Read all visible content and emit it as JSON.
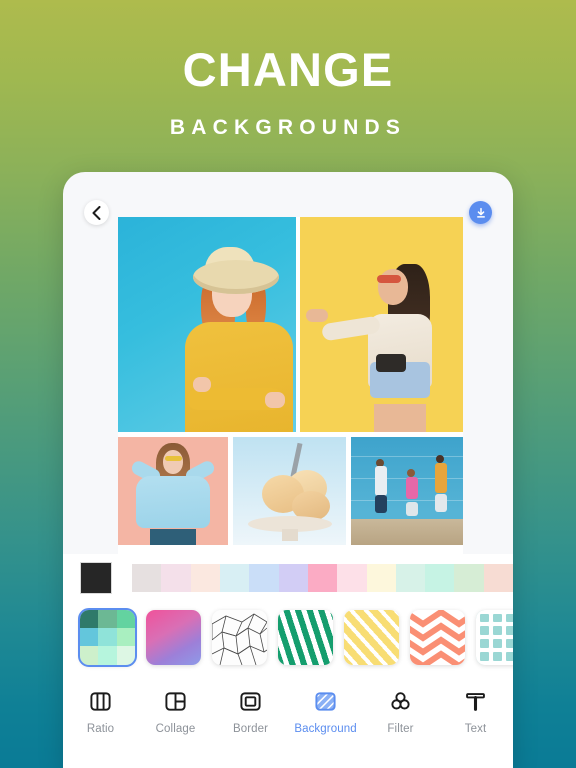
{
  "header": {
    "title": "CHANGE",
    "subtitle": "BACKGROUNDS"
  },
  "card": {
    "back_button": {
      "name": "back",
      "icon": "chevron-left-icon"
    },
    "download_button": {
      "name": "download",
      "icon": "download-icon",
      "color": "#5b8def"
    }
  },
  "collage": {
    "photos": [
      {
        "id": "photo-1",
        "description": "Smiling red-haired woman in yellow sweater and straw hat on blue background"
      },
      {
        "id": "photo-2",
        "description": "Woman with sunglasses and camera, arm outstretched, on yellow background"
      },
      {
        "id": "photo-3",
        "description": "Woman in light blue off-shoulder top on pink background"
      },
      {
        "id": "photo-4",
        "description": "Scoops of ice cream in a bowl with a spoon on blue background"
      },
      {
        "id": "photo-5",
        "description": "Three friends jumping in front of a blue wall"
      }
    ]
  },
  "panel": {
    "selected_color": "#262626",
    "palette": [
      "#e6e0e0",
      "#f4e0ea",
      "#fbe8e0",
      "#d8eff4",
      "#cadef8",
      "#d2cdf5",
      "#fbabc4",
      "#fde0e8",
      "#fdf7dc",
      "#d7f2e8",
      "#c6f3e4",
      "#d6edd5",
      "#f7dcd3"
    ],
    "patterns": [
      {
        "id": "pattern-palette",
        "label": "green-swatch-grid",
        "selected": true,
        "colors": [
          "#2f7a6a",
          "#6cb894",
          "#63d3a0",
          "#63c6dc",
          "#8fe3d9",
          "#a9efc0",
          "#cdf0cb",
          "#b6f5dd",
          "#ddf7e4"
        ]
      },
      {
        "id": "pattern-gradient",
        "label": "pink-purple-gradient",
        "selected": false
      },
      {
        "id": "pattern-geometric",
        "label": "geometric-line-mesh",
        "selected": false
      },
      {
        "id": "pattern-green-stripes",
        "label": "green-brush-stripes",
        "selected": false
      },
      {
        "id": "pattern-yellow-stripes",
        "label": "yellow-diagonal-stripes",
        "selected": false
      },
      {
        "id": "pattern-coral-chevron",
        "label": "coral-chevron",
        "selected": false
      },
      {
        "id": "pattern-teal-grid",
        "label": "teal-tile-grid",
        "selected": false
      }
    ]
  },
  "toolbar": {
    "items": [
      {
        "label": "Ratio",
        "icon": "ratio-icon",
        "active": false
      },
      {
        "label": "Collage",
        "icon": "collage-icon",
        "active": false
      },
      {
        "label": "Border",
        "icon": "border-icon",
        "active": false
      },
      {
        "label": "Background",
        "icon": "background-icon",
        "active": true
      },
      {
        "label": "Filter",
        "icon": "filter-icon",
        "active": false
      },
      {
        "label": "Text",
        "icon": "text-icon",
        "active": false
      }
    ],
    "active_color": "#5b8def",
    "inactive_color": "#8d9299"
  }
}
